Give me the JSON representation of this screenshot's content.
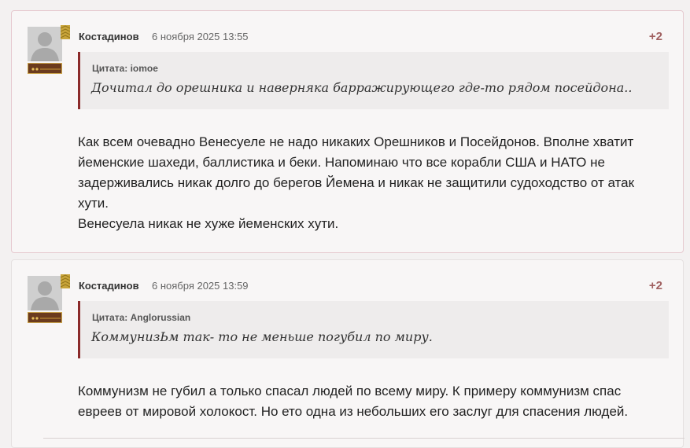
{
  "comments": [
    {
      "author": "Костадинов",
      "date": "6 ноября 2025 13:55",
      "score": "+2",
      "quote_label": "Цитата: iomoe",
      "quote_text": "Дочитал до орешника и наверняка барражирующего где-то рядом посейдона..",
      "body_lines": [
        "Как всем очевадно Венесуеле не надо никаких Орешников и Посейдонов. Вполне хватит",
        "йеменские шахеди, баллистика и беки. Напоминаю что все корабли США и НАТО не",
        "задерживались никак долго до берегов Йемена и никак не защитили судоходство от атак",
        "хути.",
        "Венесуела никак не хуже йеменских хути."
      ]
    },
    {
      "author": "Костадинов",
      "date": "6 ноября 2025 13:59",
      "score": "+2",
      "quote_label": "Цитата: Anglorussian",
      "quote_text": "КоммунизЬм так- то не меньше погубил по миру.",
      "body_lines": [
        "Коммунизм не губил а только спасал людей по всему миру. К примеру коммунизм спас",
        "евреев от мировой холокост. Но ето одна из небольших его заслуг для спасения людей."
      ]
    }
  ],
  "icons": {
    "avatar": "user-silhouette-icon",
    "rank": "rank-chevrons-icon",
    "badge": "rank-badge-icon"
  },
  "colors": {
    "score": "#a06060",
    "quote_border": "#8b2a2a"
  }
}
